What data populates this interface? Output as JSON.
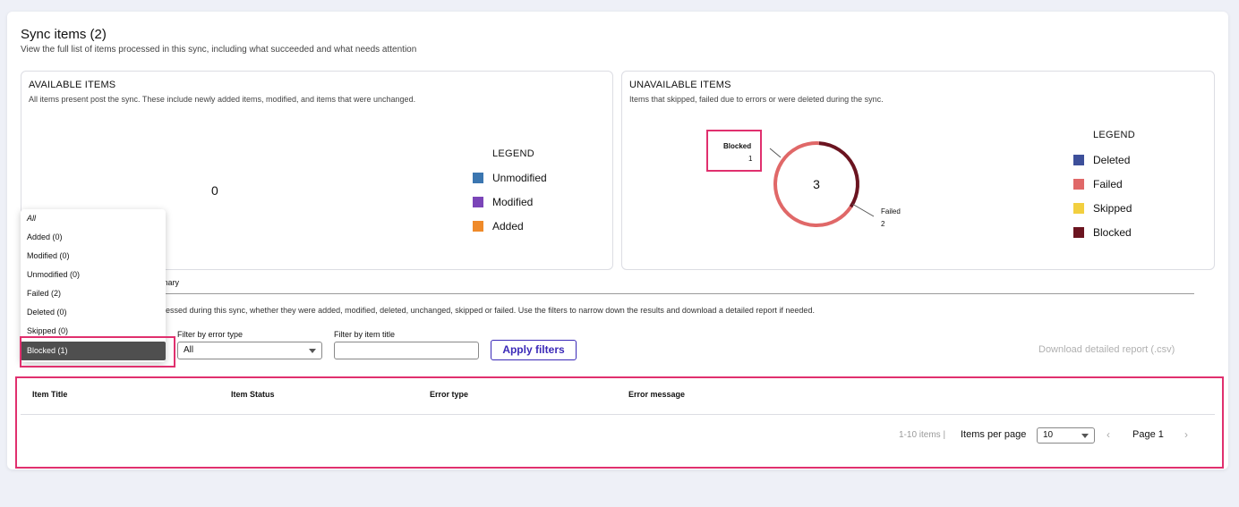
{
  "header": {
    "title": "Sync items (2)",
    "subtitle": "View the full list of items processed in this sync, including what succeeded and what needs attention"
  },
  "available": {
    "title": "AVAILABLE ITEMS",
    "description": "All items present post the sync. These include newly added items, modified, and items that were unchanged.",
    "total": "0",
    "legend_title": "LEGEND",
    "legend": [
      {
        "label": "Unmodified",
        "color": "#3b76b0"
      },
      {
        "label": "Modified",
        "color": "#7b45b8"
      },
      {
        "label": "Added",
        "color": "#ef8a2a"
      }
    ]
  },
  "unavailable": {
    "title": "UNAVAILABLE ITEMS",
    "description": "Items that skipped, failed due to errors or were deleted during the sync.",
    "total": "3",
    "legend_title": "LEGEND",
    "legend": [
      {
        "label": "Deleted",
        "color": "#3d4f9a"
      },
      {
        "label": "Failed",
        "color": "#e06868"
      },
      {
        "label": "Skipped",
        "color": "#f2cf3f"
      },
      {
        "label": "Blocked",
        "color": "#6b1420"
      }
    ],
    "callouts": {
      "blocked_label": "Blocked",
      "blocked_value": "1",
      "failed_label": "Failed",
      "failed_value": "2"
    }
  },
  "chart_data": {
    "type": "pie",
    "categories": [
      "Blocked",
      "Failed"
    ],
    "values": [
      1,
      2
    ],
    "colors": [
      "#6b1420",
      "#e06868"
    ]
  },
  "tabs": {
    "summary_partial": "mary"
  },
  "info_text": "essed during this sync, whether they were added, modified, deleted, unchanged, skipped or failed. Use the filters to narrow down the results and download a detailed report if needed.",
  "filters": {
    "error_type_label": "Filter by error type",
    "error_type_value": "All",
    "item_title_label": "Filter by item title",
    "item_title_value": "",
    "apply_label": "Apply filters",
    "download_label": "Download detailed report (.csv)"
  },
  "status_dropdown": {
    "options": [
      "All",
      "Added (0)",
      "Modified (0)",
      "Unmodified (0)",
      "Failed (2)",
      "Deleted (0)",
      "Skipped (0)",
      "Blocked (1)"
    ],
    "selected": "Blocked (1)"
  },
  "table": {
    "columns": [
      "Item Title",
      "Item Status",
      "Error type",
      "Error message"
    ]
  },
  "pagination": {
    "range": "1-10 items |",
    "items_per_page_label": "Items per page",
    "items_per_page_value": "10",
    "prev": "‹",
    "page_label": "Page 1",
    "next": "›"
  }
}
